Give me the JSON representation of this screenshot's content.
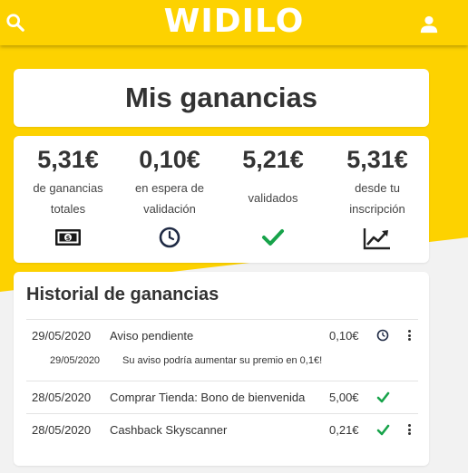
{
  "header": {
    "logo_text": "WIDILO",
    "search_icon": "search-icon",
    "user_icon": "user-icon",
    "bg_color": "#fdd200"
  },
  "page_title": "Mis ganancias",
  "stats": [
    {
      "amount": "5,31€",
      "label_line1": "de ganancias",
      "label_line2": "totales",
      "icon": "banknote-icon"
    },
    {
      "amount": "0,10€",
      "label_line1": "en espera de",
      "label_line2": "validación",
      "icon": "clock-icon"
    },
    {
      "amount": "5,21€",
      "label_line1": "validados",
      "label_line2": "",
      "icon": "check-icon"
    },
    {
      "amount": "5,31€",
      "label_line1": "desde tu",
      "label_line2": "inscripción",
      "icon": "chart-up-icon"
    }
  ],
  "history": {
    "title": "Historial de ganancias",
    "rows": [
      {
        "date": "29/05/2020",
        "description": "Aviso pendiente",
        "amount": "0,10€",
        "status": "pending",
        "has_menu": true,
        "note_date": "29/05/2020",
        "note_text": "Su aviso podría aumentar su premio en 0,1€!"
      },
      {
        "date": "28/05/2020",
        "description": "Comprar Tienda: Bono de bienvenida",
        "amount": "5,00€",
        "status": "validated",
        "has_menu": false
      },
      {
        "date": "28/05/2020",
        "description": "Cashback Skyscanner",
        "amount": "0,21€",
        "status": "validated",
        "has_menu": true
      }
    ]
  },
  "colors": {
    "validated": "#17a34a",
    "pending": "#1f2a44",
    "text": "#333333"
  }
}
